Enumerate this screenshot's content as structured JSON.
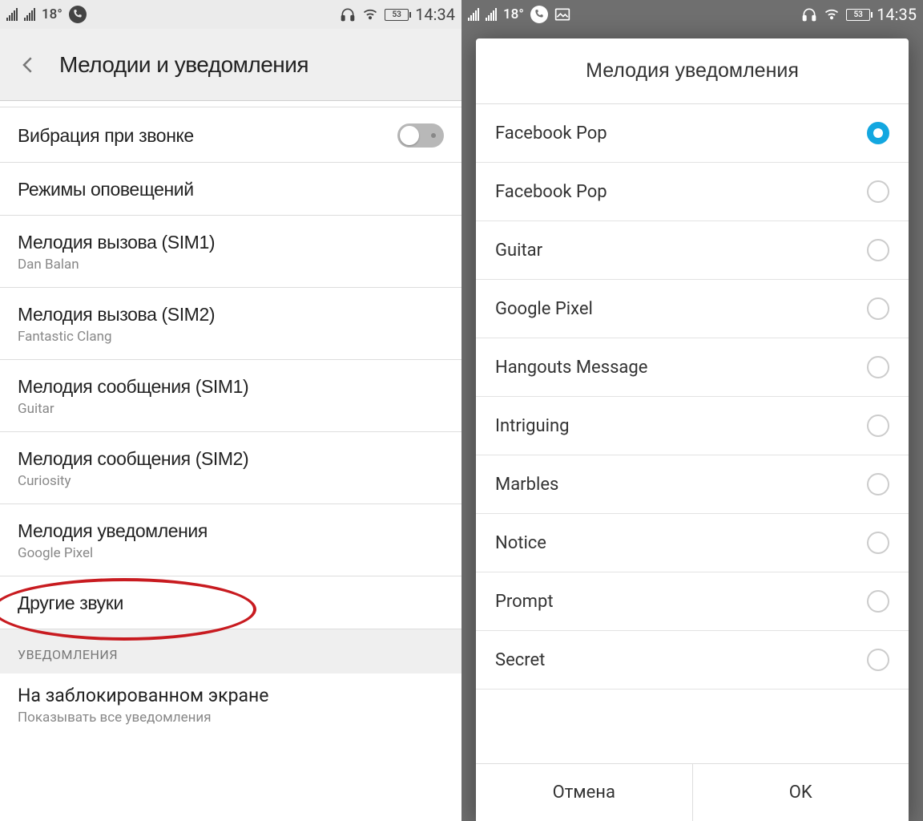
{
  "left": {
    "status": {
      "temp": "18°",
      "battery": "53",
      "time": "14:34"
    },
    "header": {
      "title": "Мелодии и уведомления"
    },
    "rows": {
      "vibrate": {
        "title": "Вибрация при звонке"
      },
      "modes": {
        "title": "Режимы оповещений"
      },
      "ring1": {
        "title": "Мелодия вызова (SIM1)",
        "sub": "Dan Balan"
      },
      "ring2": {
        "title": "Мелодия вызова (SIM2)",
        "sub": "Fantastic Clang"
      },
      "msg1": {
        "title": "Мелодия сообщения (SIM1)",
        "sub": "Guitar"
      },
      "msg2": {
        "title": "Мелодия сообщения (SIM2)",
        "sub": "Curiosity"
      },
      "notif": {
        "title": "Мелодия уведомления",
        "sub": "Google Pixel"
      },
      "other": {
        "title": "Другие звуки"
      }
    },
    "section": "УВЕДОМЛЕНИЯ",
    "lock": {
      "title": "На заблокированном экране",
      "sub": "Показывать все уведомления"
    }
  },
  "right": {
    "status": {
      "temp": "18°",
      "battery": "53",
      "time": "14:35"
    },
    "dialog": {
      "title": "Мелодия уведомления",
      "items": [
        {
          "label": "Facebook Pop",
          "selected": true
        },
        {
          "label": "Facebook Pop",
          "selected": false
        },
        {
          "label": "Guitar",
          "selected": false
        },
        {
          "label": "Google Pixel",
          "selected": false
        },
        {
          "label": "Hangouts Message",
          "selected": false
        },
        {
          "label": "Intriguing",
          "selected": false
        },
        {
          "label": "Marbles",
          "selected": false
        },
        {
          "label": "Notice",
          "selected": false
        },
        {
          "label": "Prompt",
          "selected": false
        },
        {
          "label": "Secret",
          "selected": false
        }
      ],
      "cancel": "Отмена",
      "ok": "OK"
    }
  }
}
